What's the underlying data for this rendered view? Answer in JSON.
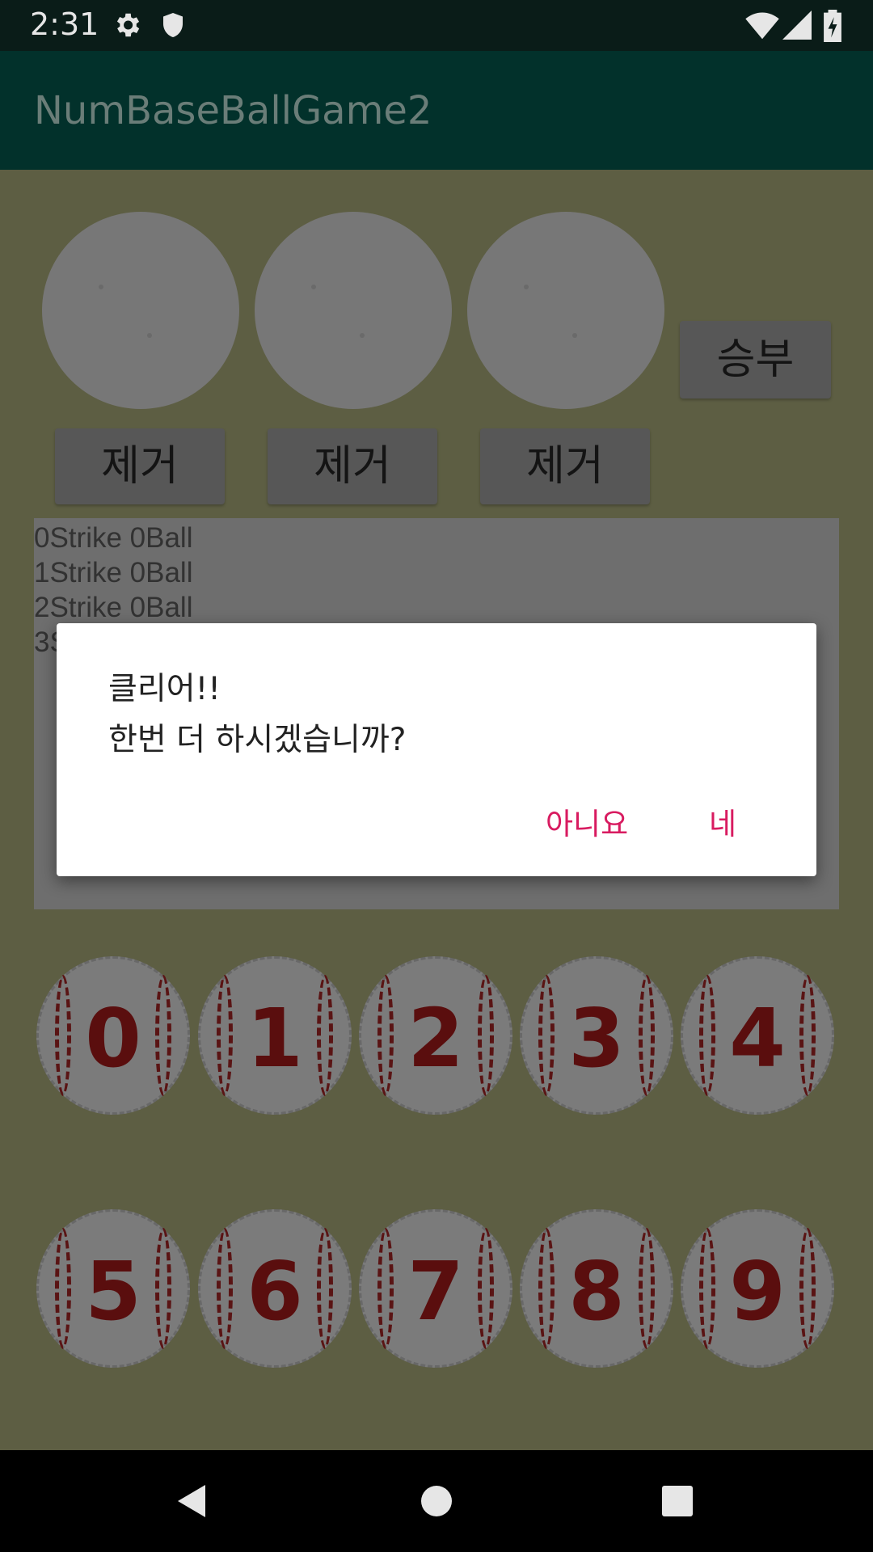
{
  "status_bar": {
    "time": "2:31",
    "icons": [
      "gear-icon",
      "shield-icon",
      "wifi-icon",
      "signal-icon",
      "battery-charging-icon"
    ]
  },
  "app_bar": {
    "title": "NumBaseBallGame2"
  },
  "colors": {
    "status_bar": "#0a1c18",
    "app_bar": "#02312b",
    "content_dimmed": "#5d5e43",
    "dialog_button": "#d81b60"
  },
  "game": {
    "submit_label": "승부",
    "remove_labels": [
      "제거",
      "제거",
      "제거"
    ],
    "results": [
      "0Strike 0Ball",
      "1Strike 0Ball",
      "2Strike 0Ball",
      "3S"
    ],
    "number_balls": [
      "0",
      "1",
      "2",
      "3",
      "4",
      "5",
      "6",
      "7",
      "8",
      "9"
    ]
  },
  "dialog": {
    "line1": "클리어!!",
    "line2": "한번 더 하시겠습니까?",
    "negative_label": "아니요",
    "positive_label": "네"
  },
  "nav_bar": {
    "icons": [
      "back-icon",
      "home-icon",
      "recents-icon"
    ]
  }
}
